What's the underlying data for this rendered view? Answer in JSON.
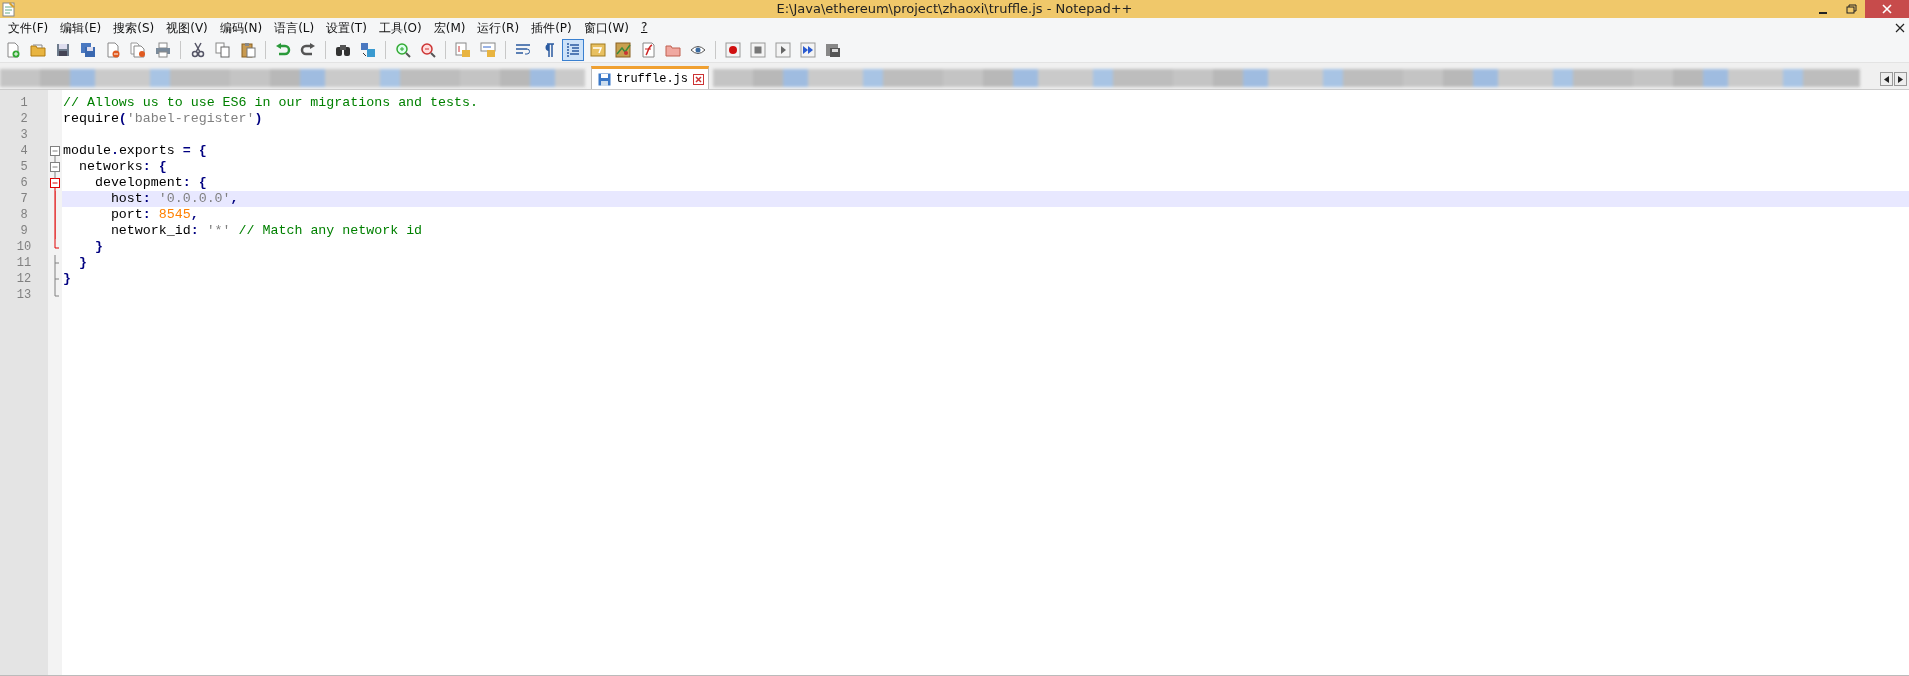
{
  "window": {
    "title": "E:\\Java\\ethereum\\project\\zhaoxi\\truffle.js - Notepad++"
  },
  "menu": [
    "文件(F)",
    "编辑(E)",
    "搜索(S)",
    "视图(V)",
    "编码(N)",
    "语言(L)",
    "设置(T)",
    "工具(O)",
    "宏(M)",
    "运行(R)",
    "插件(P)",
    "窗口(W)",
    "?"
  ],
  "toolbar": [
    {
      "kind": "new",
      "pressed": false
    },
    {
      "kind": "open",
      "pressed": false
    },
    {
      "kind": "save",
      "pressed": false
    },
    {
      "kind": "saveall",
      "pressed": false
    },
    {
      "kind": "close",
      "pressed": false
    },
    {
      "kind": "closeall",
      "pressed": false
    },
    {
      "kind": "print",
      "pressed": false
    },
    {
      "kind": "sep"
    },
    {
      "kind": "cut",
      "pressed": false
    },
    {
      "kind": "copy",
      "pressed": false
    },
    {
      "kind": "paste",
      "pressed": false
    },
    {
      "kind": "sep"
    },
    {
      "kind": "undo",
      "pressed": false
    },
    {
      "kind": "redo",
      "pressed": false
    },
    {
      "kind": "sep"
    },
    {
      "kind": "find",
      "pressed": false
    },
    {
      "kind": "replace",
      "pressed": false
    },
    {
      "kind": "sep"
    },
    {
      "kind": "zoomin",
      "pressed": false
    },
    {
      "kind": "zoomout",
      "pressed": false
    },
    {
      "kind": "sep"
    },
    {
      "kind": "syncv",
      "pressed": false
    },
    {
      "kind": "synch",
      "pressed": false
    },
    {
      "kind": "sep"
    },
    {
      "kind": "wrap",
      "pressed": false
    },
    {
      "kind": "pilcrow",
      "pressed": false
    },
    {
      "kind": "indent",
      "pressed": true
    },
    {
      "kind": "udl",
      "pressed": false
    },
    {
      "kind": "docmap",
      "pressed": false
    },
    {
      "kind": "funclist",
      "pressed": false
    },
    {
      "kind": "folder",
      "pressed": false
    },
    {
      "kind": "monitor",
      "pressed": false
    },
    {
      "kind": "sep"
    },
    {
      "kind": "record",
      "pressed": false
    },
    {
      "kind": "stop",
      "pressed": false
    },
    {
      "kind": "play",
      "pressed": false
    },
    {
      "kind": "playmulti",
      "pressed": false
    },
    {
      "kind": "savemacro",
      "pressed": false
    }
  ],
  "tabs": [
    {
      "kind": "blurred"
    },
    {
      "kind": "file",
      "label": "truffle.js",
      "selected": true
    },
    {
      "kind": "blurred"
    }
  ],
  "editor": {
    "lines": [
      {
        "number": "1",
        "tokens": [
          {
            "kind": "comment",
            "text": "// Allows us to use ES6 in our migrations and tests."
          }
        ]
      },
      {
        "number": "2",
        "tokens": [
          {
            "kind": "plain",
            "text": "require"
          },
          {
            "kind": "operator",
            "text": "("
          },
          {
            "kind": "string",
            "text": "'babel-register'"
          },
          {
            "kind": "operator",
            "text": ")"
          }
        ]
      },
      {
        "number": "3"
      },
      {
        "number": "4",
        "fold": {
          "kind": "head",
          "active": false
        },
        "tokens": [
          {
            "kind": "plain",
            "text": "module"
          },
          {
            "kind": "operator",
            "text": "."
          },
          {
            "kind": "plain",
            "text": "exports "
          },
          {
            "kind": "operator",
            "text": "= {"
          }
        ]
      },
      {
        "number": "5",
        "fold": {
          "kind": "head",
          "active": false
        },
        "tokens": [
          {
            "kind": "plain",
            "text": "  networks"
          },
          {
            "kind": "operator",
            "text": ": {"
          }
        ]
      },
      {
        "number": "6",
        "fold": {
          "kind": "head",
          "active": true
        },
        "tokens": [
          {
            "kind": "plain",
            "text": "    development"
          },
          {
            "kind": "operator",
            "text": ": {"
          }
        ]
      },
      {
        "number": "7",
        "current": true,
        "fold": {
          "kind": "body",
          "active": true
        },
        "tokens": [
          {
            "kind": "plain",
            "text": "      host"
          },
          {
            "kind": "operator",
            "text": ": "
          },
          {
            "kind": "string",
            "text": "'0.0.0.0'"
          },
          {
            "kind": "operator",
            "text": ","
          }
        ]
      },
      {
        "number": "8",
        "fold": {
          "kind": "body",
          "active": true
        },
        "tokens": [
          {
            "kind": "plain",
            "text": "      port"
          },
          {
            "kind": "operator",
            "text": ": "
          },
          {
            "kind": "number",
            "text": "8545"
          },
          {
            "kind": "operator",
            "text": ","
          }
        ]
      },
      {
        "number": "9",
        "fold": {
          "kind": "body",
          "active": true
        },
        "tokens": [
          {
            "kind": "plain",
            "text": "      network_id"
          },
          {
            "kind": "operator",
            "text": ": "
          },
          {
            "kind": "string",
            "text": "'*'"
          },
          {
            "kind": "comment",
            "text": " // Match any network id"
          }
        ]
      },
      {
        "number": "10",
        "fold": {
          "kind": "end",
          "active": true
        },
        "tokens": [
          {
            "kind": "operator",
            "text": "    }"
          }
        ]
      },
      {
        "number": "11",
        "fold": {
          "kind": "tail",
          "active": false
        },
        "tokens": [
          {
            "kind": "operator",
            "text": "  }"
          }
        ]
      },
      {
        "number": "12",
        "fold": {
          "kind": "tail",
          "active": false
        },
        "tokens": [
          {
            "kind": "operator",
            "text": "}"
          }
        ]
      },
      {
        "number": "13",
        "fold": {
          "kind": "end",
          "active": false
        }
      }
    ]
  }
}
